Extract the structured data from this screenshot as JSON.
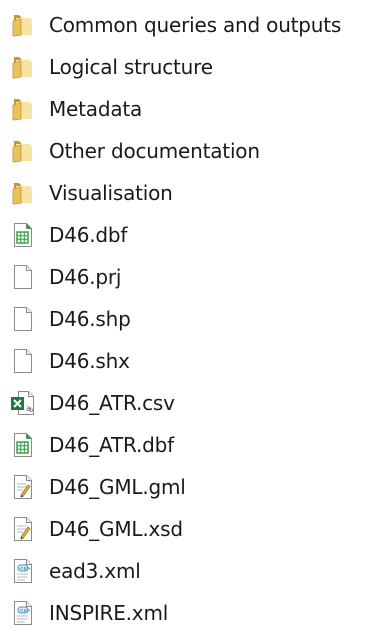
{
  "explorer": {
    "items": [
      {
        "name": "Common queries and outputs",
        "icon": "folder-icon"
      },
      {
        "name": "Logical structure",
        "icon": "folder-icon"
      },
      {
        "name": "Metadata",
        "icon": "folder-icon"
      },
      {
        "name": "Other documentation",
        "icon": "folder-icon"
      },
      {
        "name": "Visualisation",
        "icon": "folder-icon"
      },
      {
        "name": "D46.dbf",
        "icon": "spreadsheet-icon"
      },
      {
        "name": "D46.prj",
        "icon": "blank-file-icon"
      },
      {
        "name": "D46.shp",
        "icon": "blank-file-icon"
      },
      {
        "name": "D46.shx",
        "icon": "blank-file-icon"
      },
      {
        "name": "D46_ATR.csv",
        "icon": "excel-csv-icon"
      },
      {
        "name": "D46_ATR.dbf",
        "icon": "spreadsheet-icon"
      },
      {
        "name": "D46_GML.gml",
        "icon": "text-document-icon"
      },
      {
        "name": "D46_GML.xsd",
        "icon": "text-document-icon"
      },
      {
        "name": "ead3.xml",
        "icon": "xml-document-icon"
      },
      {
        "name": "INSPIRE.xml",
        "icon": "xml-document-icon"
      }
    ]
  },
  "colors": {
    "folder_main": "#e8c25a",
    "folder_dark": "#c9962b",
    "spreadsheet_green": "#2e9a3c",
    "excel_green": "#1e7a3a",
    "page_border": "#8c8c8c"
  }
}
